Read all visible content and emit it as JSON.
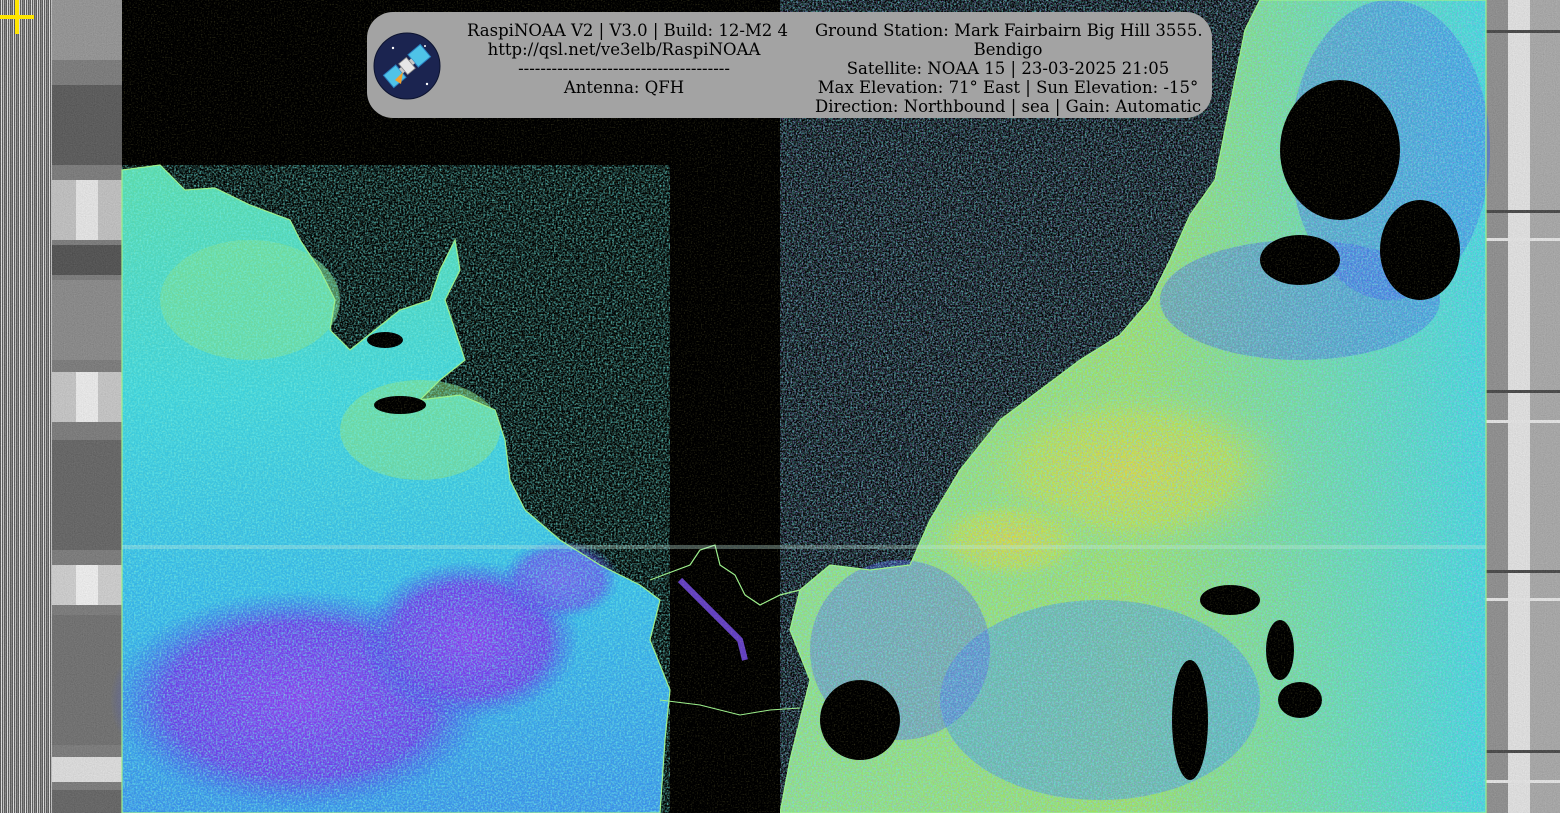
{
  "header": {
    "left_lines": [
      "RaspiNOAA V2 | V3.0 | Build: 12-M2 4",
      "http://qsl.net/ve3elb/RaspiNOAA",
      "--------------------------------------",
      "Antenna: QFH"
    ],
    "right_lines": [
      "Ground Station: Mark Fairbairn Big Hill 3555.",
      "Bendigo",
      "Satellite: NOAA 15 | 23-03-2025 21:05",
      "Max Elevation: 71° East | Sun Elevation: -15°",
      "Direction: Northbound | sea | Gain: Automatic"
    ]
  },
  "image": {
    "description_icons": [
      "satellite-logo-icon",
      "crosshair-icon"
    ],
    "palette": {
      "sea": "#000000",
      "cyan": "#3ee6dc",
      "teal": "#34c8c8",
      "green": "#78e05a",
      "yellow": "#d8e23a",
      "blue": "#3a5ae8",
      "violet": "#8a3ef0",
      "coast": "#9cf08c",
      "crosshair": "#ffe600",
      "panel": "#a3a3a3"
    }
  }
}
